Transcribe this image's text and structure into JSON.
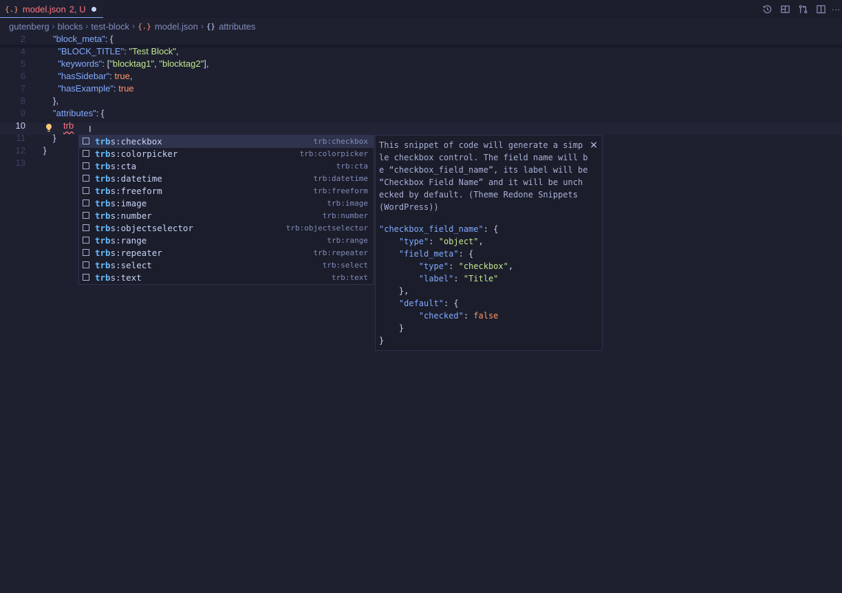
{
  "tab": {
    "icon": "{.}",
    "filename": "model.json",
    "status": "2, U"
  },
  "actions": [
    {
      "icon": "history-icon"
    },
    {
      "icon": "layout-icon"
    },
    {
      "icon": "git-compare-icon"
    },
    {
      "icon": "split-editor-icon"
    },
    {
      "icon": "more-icon",
      "label": "···"
    }
  ],
  "breadcrumb": {
    "items": [
      "gutenberg",
      "blocks",
      "test-block"
    ],
    "file_icon": "{.}",
    "file": "model.json",
    "symbol_icon": "{}",
    "symbol": "attributes"
  },
  "editor": {
    "lines": [
      {
        "n": "2",
        "tokens": [
          [
            "k",
            "\"block_meta\""
          ],
          [
            "p",
            ": {"
          ]
        ]
      },
      {
        "n": "4",
        "tokens": [
          [
            "p",
            "  "
          ],
          [
            "k",
            "\"BLOCK_TITLE\""
          ],
          [
            "p",
            ": "
          ],
          [
            "s",
            "\"Test Block\""
          ],
          [
            "p",
            ","
          ]
        ]
      },
      {
        "n": "5",
        "tokens": [
          [
            "p",
            "  "
          ],
          [
            "k",
            "\"keywords\""
          ],
          [
            "p",
            ": ["
          ],
          [
            "s",
            "\"blocktag1\""
          ],
          [
            "p",
            ", "
          ],
          [
            "s",
            "\"blocktag2\""
          ],
          [
            "p",
            "],"
          ]
        ]
      },
      {
        "n": "6",
        "tokens": [
          [
            "p",
            "  "
          ],
          [
            "k",
            "\"hasSidebar\""
          ],
          [
            "p",
            ": "
          ],
          [
            "b",
            "true"
          ],
          [
            "p",
            ","
          ]
        ]
      },
      {
        "n": "7",
        "tokens": [
          [
            "p",
            "  "
          ],
          [
            "k",
            "\"hasExample\""
          ],
          [
            "p",
            ": "
          ],
          [
            "b",
            "true"
          ]
        ]
      },
      {
        "n": "8",
        "tokens": [
          [
            "p",
            "},"
          ]
        ]
      },
      {
        "n": "9",
        "tokens": [
          [
            "k",
            "\"attributes\""
          ],
          [
            "p",
            ": {"
          ]
        ]
      },
      {
        "n": "10",
        "active": true,
        "tokens": []
      },
      {
        "n": "11",
        "tokens": [
          [
            "p",
            "}"
          ]
        ]
      },
      {
        "n": "12",
        "tokens": [
          [
            "p",
            "}"
          ]
        ]
      },
      {
        "n": "13",
        "tokens": []
      }
    ],
    "typed": "trb"
  },
  "suggestions": [
    {
      "match": "trb",
      "rest": "s:checkbox",
      "detail": "trb:checkbox",
      "selected": true
    },
    {
      "match": "trb",
      "rest": "s:colorpicker",
      "detail": "trb:colorpicker"
    },
    {
      "match": "trb",
      "rest": "s:cta",
      "detail": "trb:cta"
    },
    {
      "match": "trb",
      "rest": "s:datetime",
      "detail": "trb:datetime"
    },
    {
      "match": "trb",
      "rest": "s:freeform",
      "detail": "trb:freeform"
    },
    {
      "match": "trb",
      "rest": "s:image",
      "detail": "trb:image"
    },
    {
      "match": "trb",
      "rest": "s:number",
      "detail": "trb:number"
    },
    {
      "match": "trb",
      "rest": "s:objectselector",
      "detail": "trb:objectselector"
    },
    {
      "match": "trb",
      "rest": "s:range",
      "detail": "trb:range"
    },
    {
      "match": "trb",
      "rest": "s:repeater",
      "detail": "trb:repeater"
    },
    {
      "match": "trb",
      "rest": "s:select",
      "detail": "trb:select"
    },
    {
      "match": "trb",
      "rest": "s:text",
      "detail": "trb:text"
    }
  ],
  "docs": {
    "close": "×",
    "description": "This snippet of code will generate a simp\nle checkbox control. The field name will b\ne “checkbox_field_name”, its label will be\n“Checkbox Field Name” and it will be unch\necked by default. (Theme Redone Snippets\n(WordPress))",
    "snippet": [
      [
        [
          "k",
          "\"checkbox_field_name\""
        ],
        [
          "p",
          ": {"
        ]
      ],
      [
        [
          "p",
          "    "
        ],
        [
          "k",
          "\"type\""
        ],
        [
          "p",
          ": "
        ],
        [
          "s",
          "\"object\""
        ],
        [
          "p",
          ","
        ]
      ],
      [
        [
          "p",
          "    "
        ],
        [
          "k",
          "\"field_meta\""
        ],
        [
          "p",
          ": {"
        ]
      ],
      [
        [
          "p",
          "        "
        ],
        [
          "k",
          "\"type\""
        ],
        [
          "p",
          ": "
        ],
        [
          "s",
          "\"checkbox\""
        ],
        [
          "p",
          ","
        ]
      ],
      [
        [
          "p",
          "        "
        ],
        [
          "k",
          "\"label\""
        ],
        [
          "p",
          ": "
        ],
        [
          "s",
          "\"Title\""
        ]
      ],
      [
        [
          "p",
          "    },"
        ]
      ],
      [
        [
          "p",
          "    "
        ],
        [
          "k",
          "\"default\""
        ],
        [
          "p",
          ": {"
        ]
      ],
      [
        [
          "p",
          "        "
        ],
        [
          "k",
          "\"checked\""
        ],
        [
          "p",
          ": "
        ],
        [
          "b",
          "false"
        ]
      ],
      [
        [
          "p",
          "    }"
        ]
      ],
      [
        [
          "p",
          "}"
        ]
      ]
    ]
  }
}
